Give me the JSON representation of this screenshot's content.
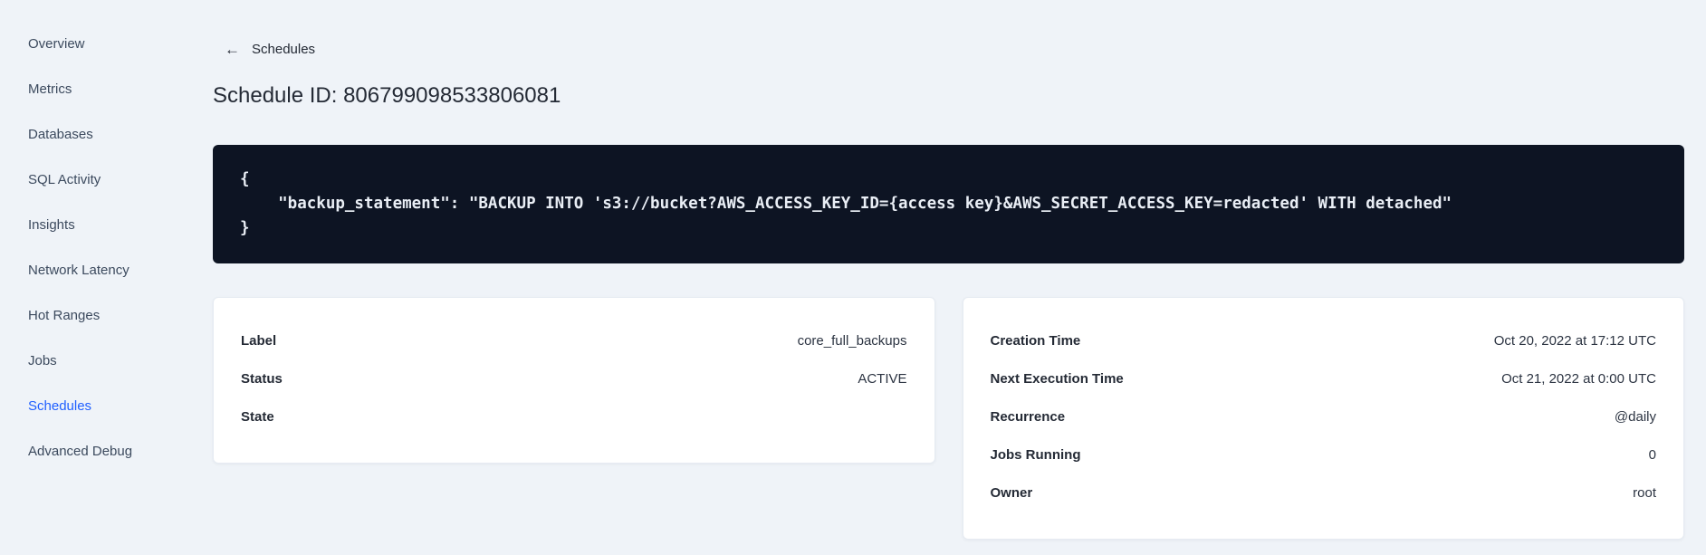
{
  "sidebar": {
    "items": [
      {
        "label": "Overview",
        "active": false
      },
      {
        "label": "Metrics",
        "active": false
      },
      {
        "label": "Databases",
        "active": false
      },
      {
        "label": "SQL Activity",
        "active": false
      },
      {
        "label": "Insights",
        "active": false
      },
      {
        "label": "Network Latency",
        "active": false
      },
      {
        "label": "Hot Ranges",
        "active": false
      },
      {
        "label": "Jobs",
        "active": false
      },
      {
        "label": "Schedules",
        "active": true
      },
      {
        "label": "Advanced Debug",
        "active": false
      }
    ]
  },
  "page": {
    "back_icon": "←",
    "back_label": "Schedules",
    "title": "Schedule ID: 806799098533806081"
  },
  "code_block": {
    "line1": "{",
    "line2": "    \"backup_statement\": \"BACKUP INTO 's3://bucket?AWS_ACCESS_KEY_ID={access key}&AWS_SECRET_ACCESS_KEY=redacted' WITH detached\"",
    "line3": "}"
  },
  "schedule_card": {
    "rows": [
      {
        "label": "Label",
        "value": "core_full_backups"
      },
      {
        "label": "Status",
        "value": "ACTIVE"
      },
      {
        "label": "State",
        "value": ""
      }
    ]
  },
  "details_card": {
    "rows": [
      {
        "label": "Creation Time",
        "value": "Oct 20, 2022 at 17:12 UTC"
      },
      {
        "label": "Next Execution Time",
        "value": "Oct 21, 2022 at 0:00 UTC"
      },
      {
        "label": "Recurrence",
        "value": "@daily"
      },
      {
        "label": "Jobs Running",
        "value": "0"
      },
      {
        "label": "Owner",
        "value": "root"
      }
    ]
  },
  "colors": {
    "page_background": "#eff3f8",
    "active_nav": "#2160ff",
    "code_background": "#0d1423",
    "code_text": "#e9eef5",
    "card_background": "#ffffff",
    "text": "#242a35"
  }
}
